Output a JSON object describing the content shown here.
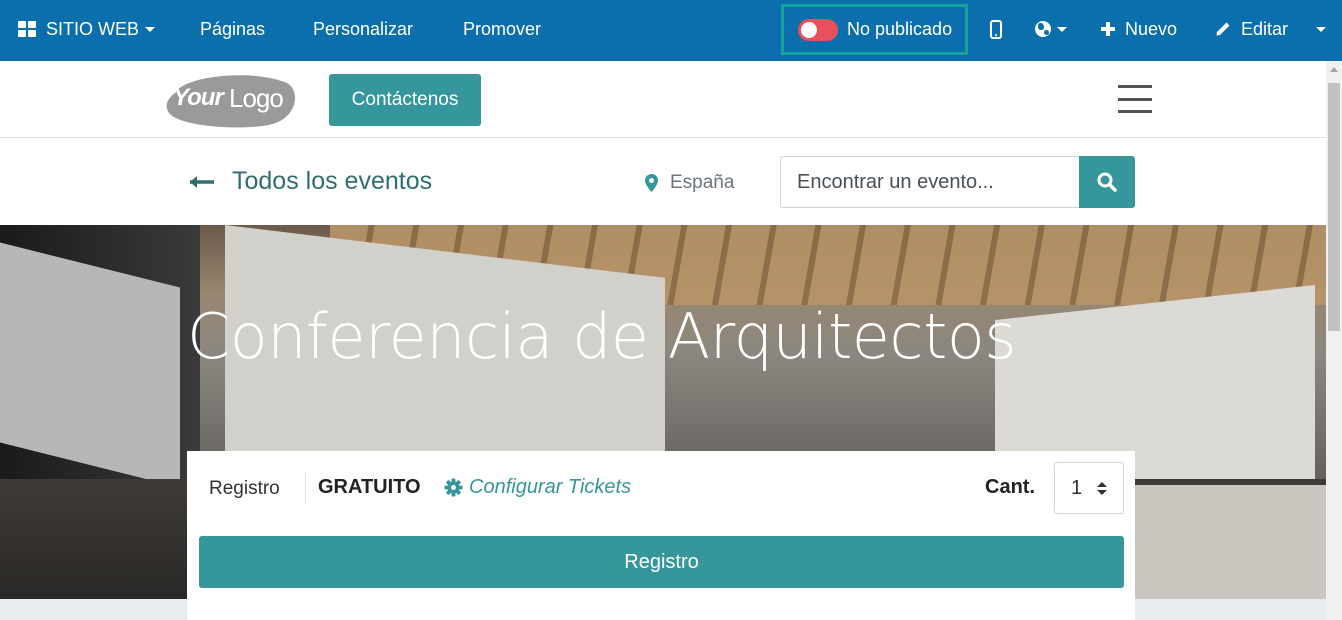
{
  "topbar": {
    "app_label": "SITIO WEB",
    "menu": [
      "Páginas",
      "Personalizar",
      "Promover"
    ],
    "publish_status": "No publicado",
    "new_label": "Nuevo",
    "edit_label": "Editar",
    "bg_color": "#0b6fae",
    "highlight_color": "#14a396",
    "toggle_color": "#e8505e"
  },
  "header": {
    "logo_text": "YourLogo",
    "contact_label": "Contáctenos",
    "accent_color": "#35979c"
  },
  "subnav": {
    "back_label": "Todos los eventos",
    "location": "España",
    "search_placeholder": "Encontrar un evento..."
  },
  "hero": {
    "title": "Conferencia de Arquitectos"
  },
  "registration": {
    "label": "Registro",
    "price": "GRATUITO",
    "config_link": "Configurar Tickets",
    "qty_label": "Cant.",
    "qty_value": "1",
    "button_label": "Registro"
  }
}
